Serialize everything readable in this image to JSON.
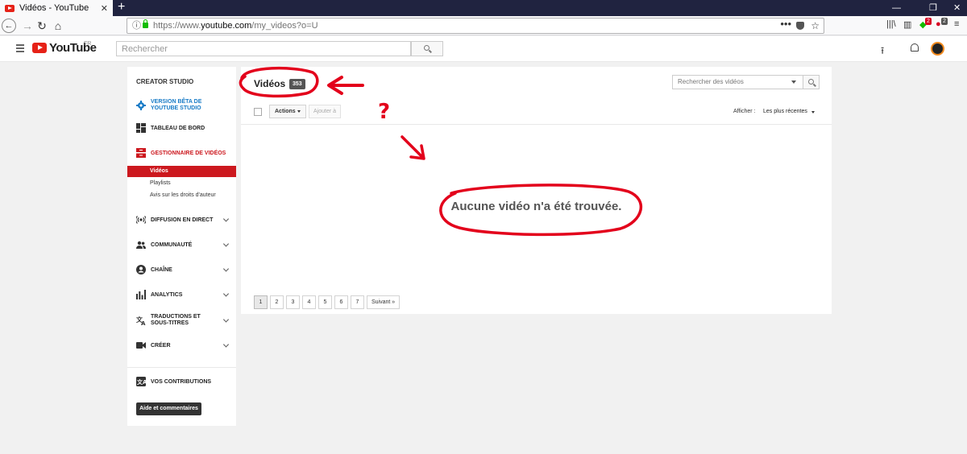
{
  "browser": {
    "tab_title": "Vidéos - YouTube",
    "tab_close": "✕",
    "new_tab": "+",
    "url_host": "https://www.",
    "url_domain": "youtube.com",
    "url_path": "/my_videos?o=U",
    "window_controls": [
      "—",
      "❐",
      "✕"
    ],
    "badges": [
      "2",
      "2"
    ]
  },
  "youtube": {
    "logo_text": "YouTube",
    "country": "FR",
    "search_placeholder": "Rechercher"
  },
  "sidebar": {
    "title": "CREATOR STUDIO",
    "items": [
      {
        "label": "VERSION BÊTA DE YOUTUBE STUDIO",
        "icon": "gear-icon",
        "color": "#167ac6"
      },
      {
        "label": "TABLEAU DE BORD",
        "icon": "dashboard-icon"
      },
      {
        "label": "GESTIONNAIRE DE VIDÉOS",
        "icon": "video-manager-icon",
        "color": "#cc181e"
      },
      {
        "label": "DIFFUSION EN DIRECT",
        "icon": "live-icon"
      },
      {
        "label": "COMMUNAUTÉ",
        "icon": "community-icon"
      },
      {
        "label": "CHAÎNE",
        "icon": "channel-icon"
      },
      {
        "label": "ANALYTICS",
        "icon": "analytics-icon"
      },
      {
        "label": "TRADUCTIONS ET SOUS-TITRES",
        "icon": "translate-icon"
      },
      {
        "label": "CRÉER",
        "icon": "camera-icon"
      },
      {
        "label": "VOS CONTRIBUTIONS",
        "icon": "contributions-icon"
      }
    ],
    "subitems": [
      "Vidéos",
      "Playlists",
      "Avis sur les droits d'auteur"
    ],
    "help_button": "Aide et commentaires"
  },
  "main": {
    "title": "Vidéos",
    "count": "353",
    "search_placeholder": "Rechercher des vidéos",
    "actions_label": "Actions",
    "add_to_label": "Ajouter à",
    "show_label": "Afficher :",
    "sort_value": "Les plus récentes",
    "empty_message": "Aucune vidéo n'a été trouvée.",
    "pages": [
      "1",
      "2",
      "3",
      "4",
      "5",
      "6",
      "7"
    ],
    "next_label": "Suivant »"
  },
  "annotation": {
    "question_mark": "?",
    "color": "#e3001b"
  }
}
